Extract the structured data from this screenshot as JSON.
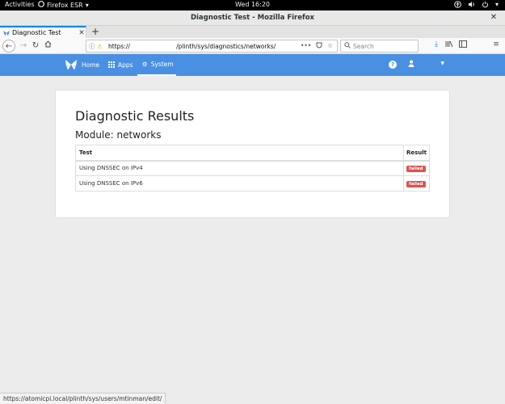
{
  "system_bar": {
    "activities": "Activities",
    "app_name": "Firefox ESR",
    "clock": "Wed 16:20"
  },
  "window": {
    "title": "Diagnostic Test - Mozilla Firefox"
  },
  "browser": {
    "tab_title": "Diagnostic Test",
    "url": "https://                        /plinth/sys/diagnostics/networks/",
    "search_placeholder": "Search",
    "status_url": "https://atomicpi.local/plinth/sys/users/mtinman/edit/"
  },
  "appnav": {
    "items": [
      {
        "label": "Home"
      },
      {
        "label": "Apps"
      },
      {
        "label": "System"
      }
    ]
  },
  "page": {
    "title": "Diagnostic Results",
    "module_heading": "Module: networks",
    "table": {
      "headers": [
        "Test",
        "Result"
      ],
      "rows": [
        {
          "test": "Using DNSSEC on IPv4",
          "result": "failed"
        },
        {
          "test": "Using DNSSEC on IPv6",
          "result": "failed"
        }
      ]
    }
  },
  "colors": {
    "navbar": "#4a90e2",
    "failed_badge": "#d9534f"
  }
}
